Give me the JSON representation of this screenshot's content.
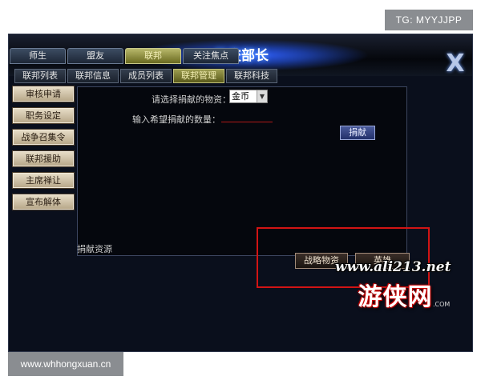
{
  "overlay": {
    "top_badge": "TG: MYYJJPP",
    "bottom_badge": "www.whhongxuan.cn"
  },
  "window": {
    "title": "外交部长",
    "close_glyph": "X",
    "close_icon": "close-x-icon"
  },
  "tabs_primary": [
    {
      "label": "师生",
      "active": false
    },
    {
      "label": "盟友",
      "active": false
    },
    {
      "label": "联邦",
      "active": true
    },
    {
      "label": "关注焦点",
      "active": false
    }
  ],
  "tabs_secondary": [
    {
      "label": "联邦列表",
      "active": false
    },
    {
      "label": "联邦信息",
      "active": false
    },
    {
      "label": "成员列表",
      "active": false
    },
    {
      "label": "联邦管理",
      "active": true
    },
    {
      "label": "联邦科技",
      "active": false
    }
  ],
  "sidebar": {
    "items": [
      {
        "label": "审核申请"
      },
      {
        "label": "职务设定"
      },
      {
        "label": "战争召集令"
      },
      {
        "label": "联邦援助"
      },
      {
        "label": "主席禅让"
      },
      {
        "label": "宣布解体"
      }
    ]
  },
  "donation": {
    "select_label": "请选择捐献的物资：",
    "select_value": "金币",
    "quantity_label": "输入希望捐献的数量：",
    "quantity_value": "",
    "donate_button": "捐献",
    "resources_label": "捐献资源"
  },
  "actions": {
    "strategic_button": "战略物资",
    "hero_button": "英雄"
  },
  "watermark": {
    "url": "www.ali213.net",
    "logo": "游侠网",
    "com": ".COM"
  },
  "colors": {
    "highlight_box": "#d21414",
    "active_tab": "#9c9c50",
    "window_bg": "#0a0f1c"
  }
}
